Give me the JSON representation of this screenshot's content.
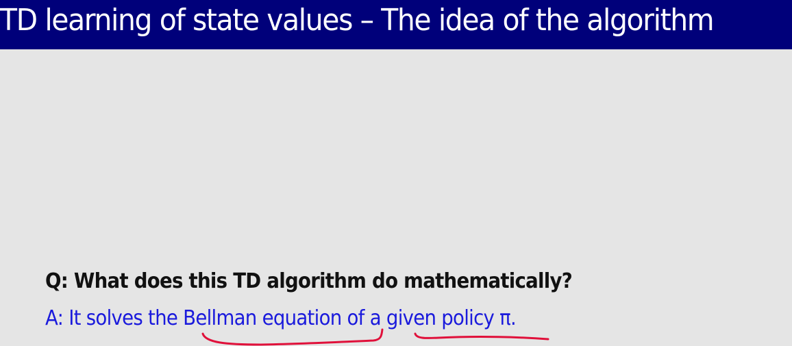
{
  "slide": {
    "title": "TD learning of state values – The idea of the algorithm",
    "question": "Q: What does this TD algorithm do mathematically?",
    "answer_parts": [
      "A: It solves the ",
      "Bellman equation",
      " of ",
      "a given policy",
      " π."
    ],
    "annotation_color": "#e0103a",
    "header_color": "#00007a"
  }
}
